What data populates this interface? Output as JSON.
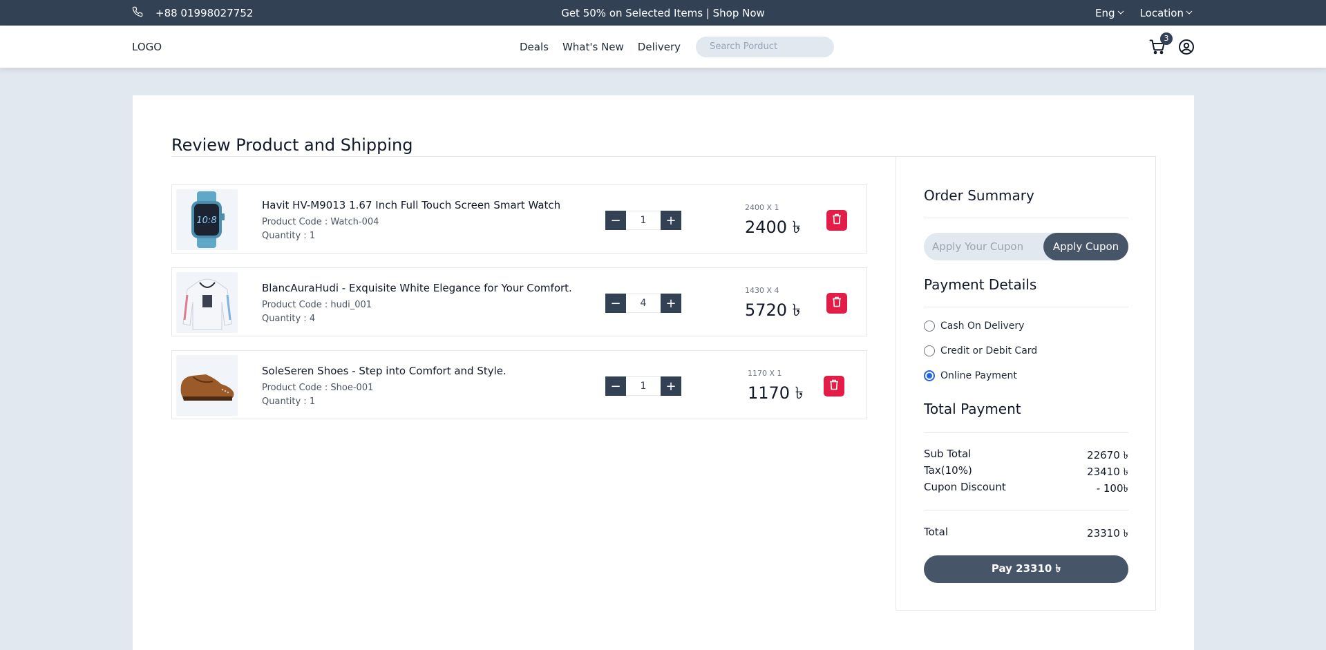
{
  "topbar": {
    "phone": "+88 01998027752",
    "promo": "Get 50% on Selected Items | Shop Now",
    "language": "Eng",
    "location": "Location"
  },
  "nav": {
    "logo": "LOGO",
    "links": [
      "Deals",
      "What's New",
      "Delivery"
    ],
    "search_placeholder": "Search Porduct",
    "cart_count": "3"
  },
  "page": {
    "title": "Review Product and Shipping"
  },
  "cart_items": [
    {
      "name": "Havit HV-M9013 1.67 Inch Full Touch Screen Smart Watch",
      "code": "Product Code : Watch-004",
      "quantity_label": "Quantity : 1",
      "qty": "1",
      "calc": "2400 X 1",
      "total": "2400 ৳",
      "image_icon": "smartwatch-image"
    },
    {
      "name": "BlancAuraHudi - Exquisite White Elegance for Your Comfort.",
      "code": "Product Code : hudi_001",
      "quantity_label": "Quantity : 4",
      "qty": "4",
      "calc": "1430 X 4",
      "total": "5720 ৳",
      "image_icon": "hoodie-image"
    },
    {
      "name": "SoleSeren Shoes - Step into Comfort and Style.",
      "code": "Product Code : Shoe-001",
      "quantity_label": "Quantity : 1",
      "qty": "1",
      "calc": "1170 X 1",
      "total": "1170 ৳",
      "image_icon": "shoe-image"
    }
  ],
  "summary": {
    "order_title": "Order Summary",
    "coupon_placeholder": "Apply Your Cupon",
    "coupon_button": "Apply Cupon",
    "payment_title": "Payment Details",
    "payment_options": [
      "Cash On Delivery",
      "Credit or Debit Card",
      "Online Payment"
    ],
    "selected_payment": "Online Payment",
    "total_title": "Total Payment",
    "subtotal_label": "Sub Total",
    "subtotal_value": "22670 ৳",
    "tax_label": "Tax(10%)",
    "tax_value": "23410 ৳",
    "discount_label": "Cupon Discount",
    "discount_value": "- 100৳",
    "total_label": "Total",
    "total_value": "23310 ৳",
    "pay_button": "Pay 23310 ৳"
  },
  "colors": {
    "dark": "#334155",
    "button": "#475569",
    "delete": "#e11d48",
    "page_bg": "#e2e8f0",
    "radio_selected": "#2563eb"
  }
}
